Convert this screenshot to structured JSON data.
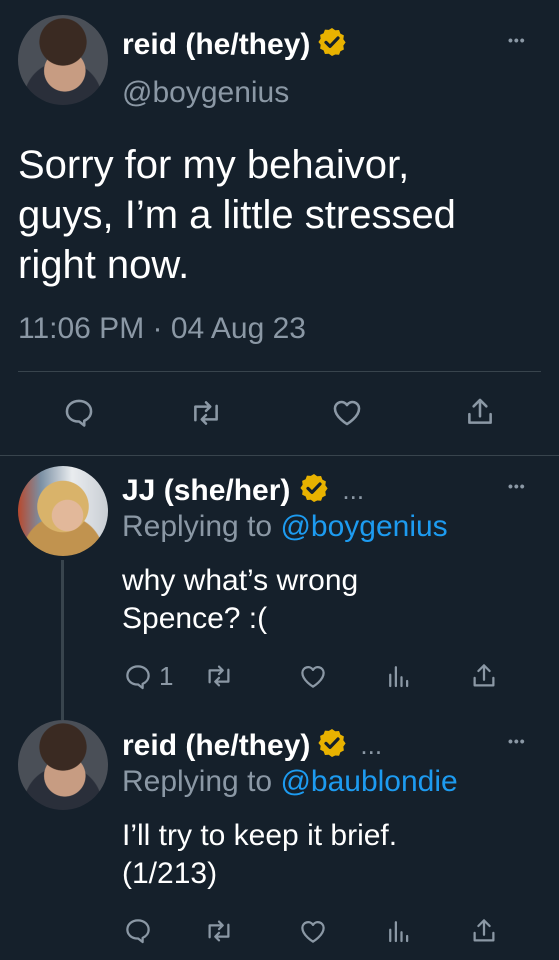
{
  "main_tweet": {
    "display_name": "reid (he/they)",
    "handle": "@boygenius",
    "text_lines": [
      "Sorry for my behaivor,",
      "guys, I’m a little stressed",
      "right now."
    ],
    "timestamp": "11:06 PM · 04 Aug 23"
  },
  "reply1": {
    "display_name": "JJ (she/her)",
    "extra": "...",
    "replying_label": "Replying to",
    "replying_to": "@boygenius",
    "text_lines": [
      "why what’s wrong",
      "Spence? :("
    ],
    "reply_count": "1"
  },
  "reply2": {
    "display_name": "reid (he/they)",
    "extra": "...",
    "replying_label": "Replying to",
    "replying_to": "@baublondie",
    "text_lines": [
      "I’ll try to keep it brief.",
      "(1/213)"
    ]
  },
  "more_menu": "•••",
  "colors": {
    "background": "#15202b",
    "muted": "#8b98a5",
    "link": "#1d9bf0",
    "verified": "#e8b200",
    "divider": "#38444d"
  },
  "icons": [
    "reply-icon",
    "retweet-icon",
    "like-icon",
    "views-icon",
    "share-icon",
    "verified-icon",
    "more-icon"
  ]
}
